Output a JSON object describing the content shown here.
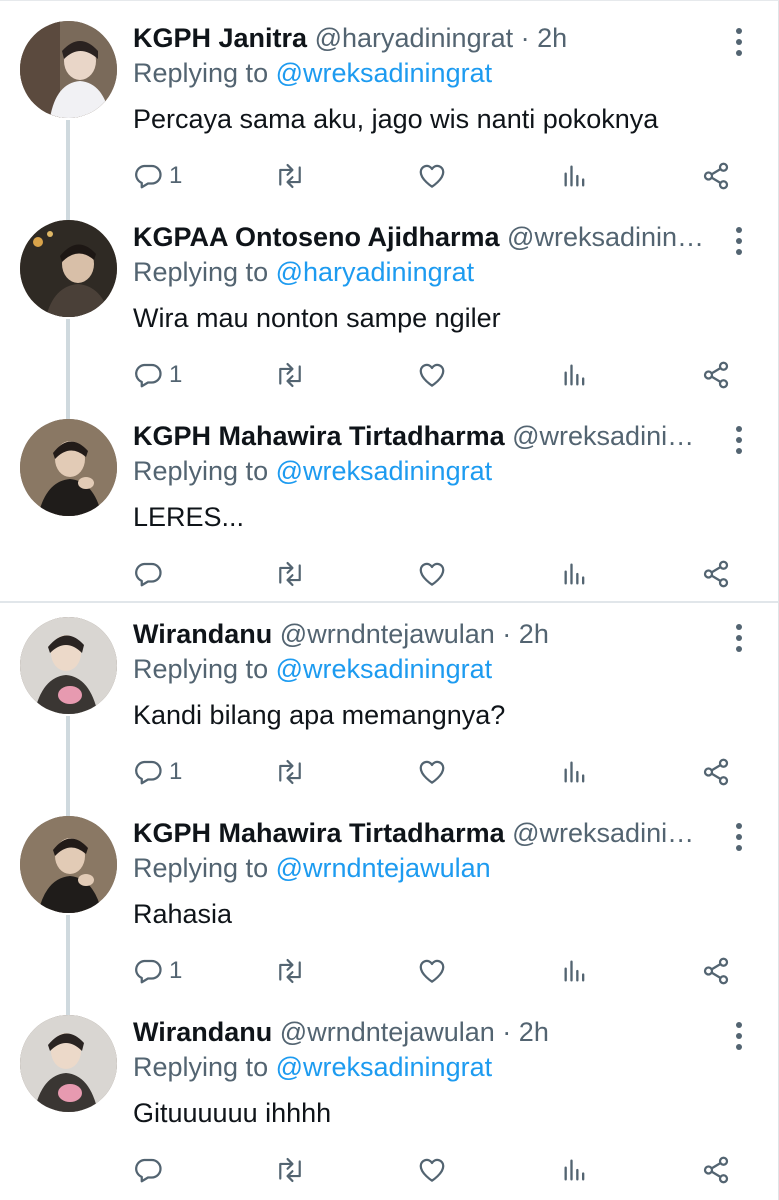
{
  "colors": {
    "text": "#0f1419",
    "secondary": "#536471",
    "link": "#1d9bf0",
    "thread_line": "#cfd9de"
  },
  "icons": {
    "reply": "reply-icon",
    "retweet": "retweet-icon",
    "like": "heart-icon",
    "stats": "analytics-icon",
    "share": "share-icon",
    "more": "more-vertical-icon"
  },
  "tweets": [
    {
      "name": "KGPH Janitra",
      "meta": "@haryadiningrat · 2h",
      "replying_prefix": "Replying to ",
      "replying_handle": "@wreksadiningrat",
      "text": "Percaya sama aku, jago wis nanti pokoknya",
      "reply_count": "1"
    },
    {
      "name": "KGPAA Ontoseno Ajidharma",
      "meta": "@wreksadinin…",
      "replying_prefix": "Replying to ",
      "replying_handle": "@haryadiningrat",
      "text": "Wira mau nonton sampe ngiler",
      "reply_count": "1"
    },
    {
      "name": "KGPH Mahawira Tirtadharma",
      "meta": "@wreksadini…",
      "replying_prefix": "Replying to ",
      "replying_handle": "@wreksadiningrat",
      "text": "LERES...",
      "reply_count": ""
    },
    {
      "name": "Wirandanu",
      "meta": "@wrndntejawulan · 2h",
      "replying_prefix": "Replying to ",
      "replying_handle": "@wreksadiningrat",
      "text": "Kandi bilang apa memangnya?",
      "reply_count": "1"
    },
    {
      "name": "KGPH Mahawira Tirtadharma",
      "meta": "@wreksadini…",
      "replying_prefix": "Replying to ",
      "replying_handle": "@wrndntejawulan",
      "text": "Rahasia",
      "reply_count": "1"
    },
    {
      "name": "Wirandanu",
      "meta": "@wrndntejawulan · 2h",
      "replying_prefix": "Replying to ",
      "replying_handle": "@wreksadiningrat",
      "text": "Gituuuuuu ihhhh",
      "reply_count": ""
    }
  ]
}
